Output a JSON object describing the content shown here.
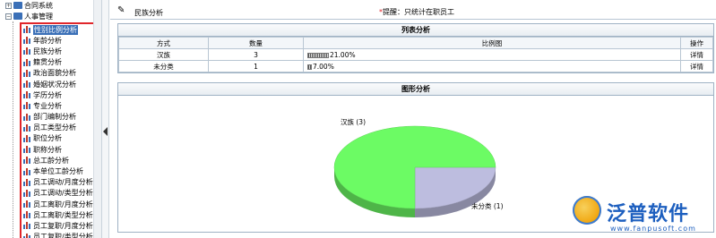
{
  "tree": {
    "top_items": [
      "合同系统",
      "人事管理"
    ],
    "items": [
      "性别比例分析",
      "年龄分析",
      "民族分析",
      "籍贯分析",
      "政治面貌分析",
      "婚姻状况分析",
      "学历分析",
      "专业分析",
      "部门编制分析",
      "员工类型分析",
      "职位分析",
      "职称分析",
      "总工龄分析",
      "本单位工龄分析",
      "员工调动/月度分析",
      "员工调动/类型分析",
      "员工离职/月度分析",
      "员工离职/类型分析",
      "员工复职/月度分析",
      "员工复职/类型分析"
    ],
    "selected_index": 0
  },
  "header": {
    "page_title": "民族分析",
    "notice_star": "*",
    "notice": "提醒：只统计在职员工"
  },
  "list_panel": {
    "title": "列表分析",
    "columns": [
      "方式",
      "数量",
      "比例图",
      "操作"
    ],
    "rows": [
      {
        "type": "汉族",
        "count": "3",
        "ratio": "21.00%",
        "ratio_value": 0.21,
        "op": "详情"
      },
      {
        "type": "未分类",
        "count": "1",
        "ratio": "7.00%",
        "ratio_value": 0.07,
        "op": "详情"
      }
    ]
  },
  "chart_panel": {
    "title": "图形分析"
  },
  "chart_data": {
    "type": "pie",
    "slices": [
      {
        "label": "汉族 (3)",
        "value": 3,
        "color": "#6cfb64"
      },
      {
        "label": "未分类 (1)",
        "value": 1,
        "color": "#bdbddf"
      }
    ]
  },
  "logo": {
    "name": "泛普软件",
    "url": "www.fanpusoft.com"
  },
  "colors": {
    "tree_border": "#e0262b",
    "han": "#6cfb64",
    "other": "#bdbddf",
    "brand": "#1d5fbf"
  }
}
